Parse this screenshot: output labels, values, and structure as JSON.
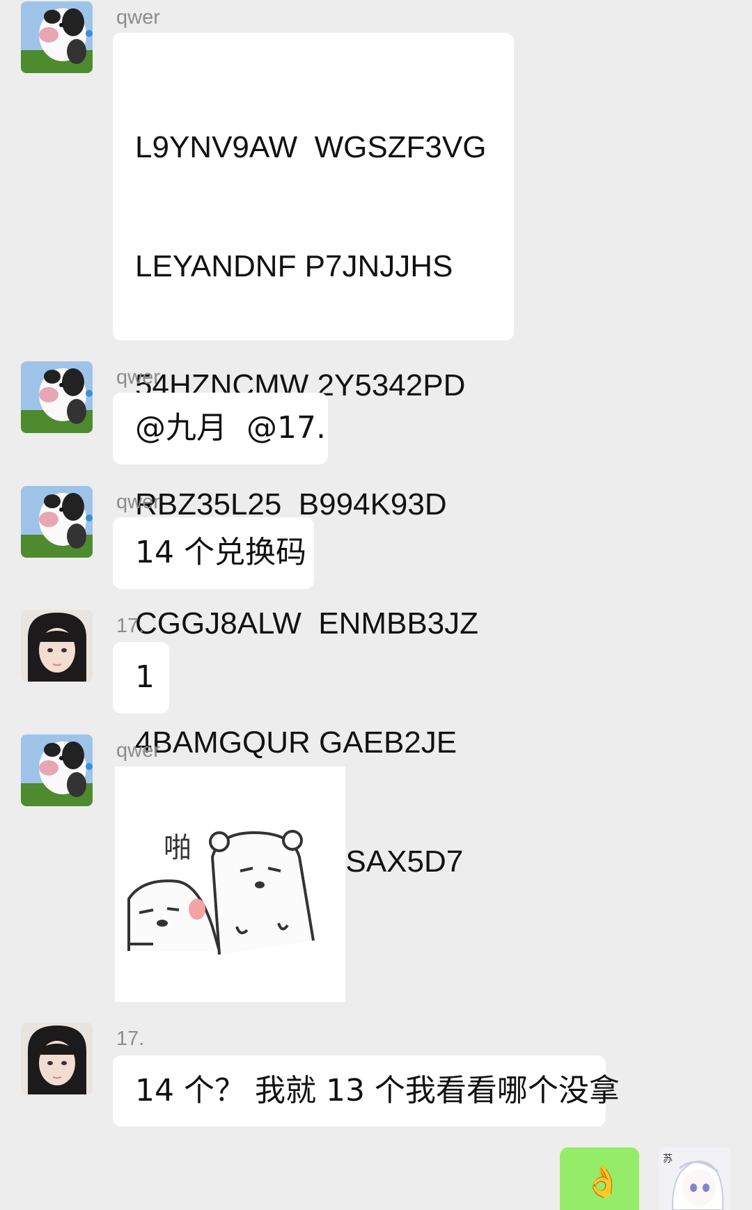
{
  "messages": [
    {
      "sender": "qwer",
      "lines": [
        "L9YNV9AW  WGSZF3VG",
        "LEYANDNF P7JNJJHS",
        "54HZNCMW 2Y5342PD",
        "RBZ35L25  B994K93D",
        "CGGJ8ALW  ENMBB3JZ",
        "4BAMGQUR GAEB2JE",
        "7AQ27QFT  7SSAX5D7"
      ]
    },
    {
      "sender": "qwer",
      "text": "@九月  @17."
    },
    {
      "sender": "qwer",
      "text": "14 个兑换码"
    },
    {
      "sender": "17.",
      "text": "1"
    },
    {
      "sender": "qwer",
      "sticker": {
        "caption": "啪"
      }
    },
    {
      "sender": "17.",
      "text": "14 个？ 我就 13 个我看看哪个没拿"
    }
  ],
  "mine": {
    "avatar_text": "苏",
    "emoji": "👌"
  },
  "colors": {
    "background": "#ededed",
    "bubble": "#ffffff",
    "mine_bubble": "#95ec69"
  }
}
